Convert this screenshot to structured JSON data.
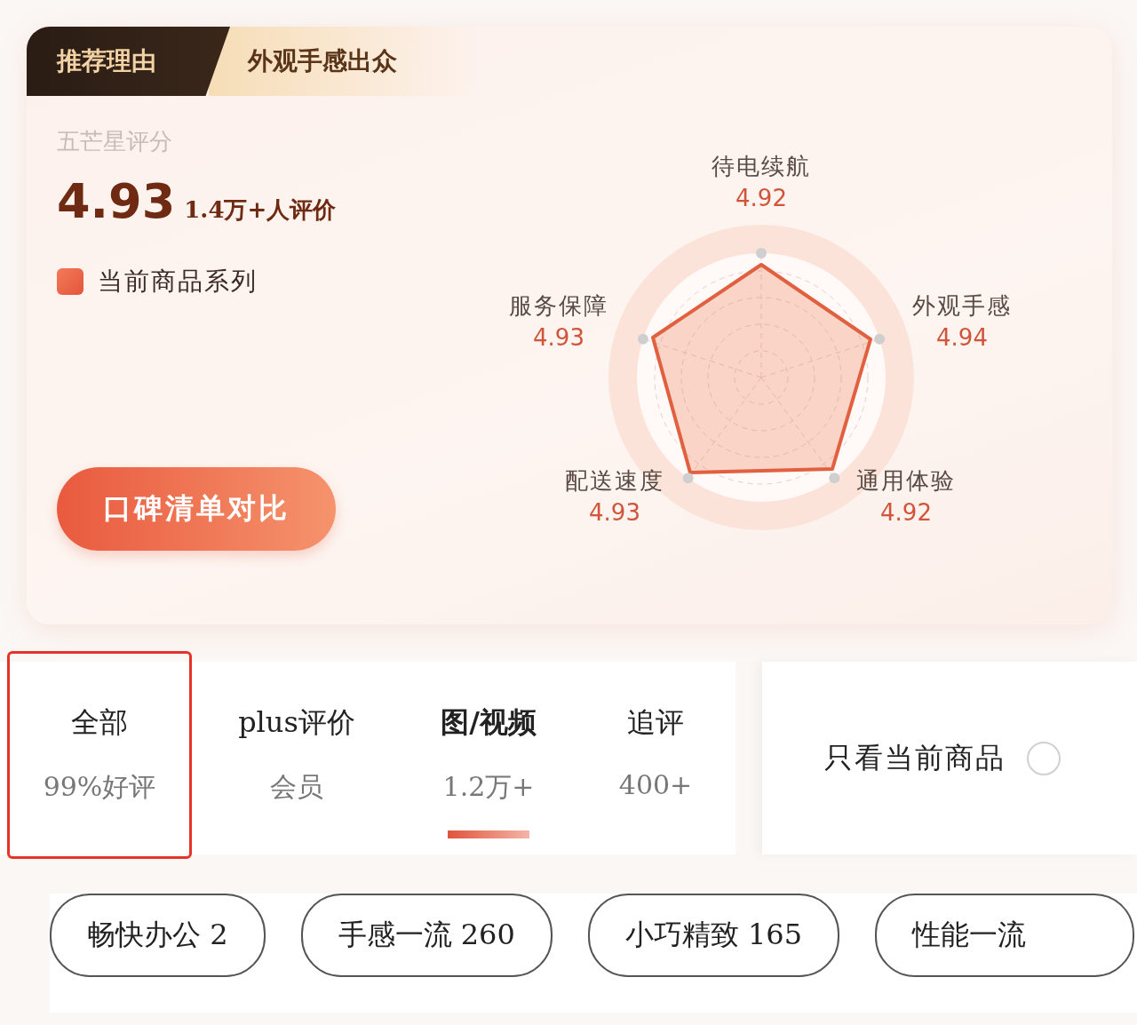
{
  "recommend": {
    "tag": "推荐理由",
    "reason": "外观手感出众"
  },
  "rating": {
    "label": "五芒星评分",
    "score": "4.93",
    "count": "1.4万+人评价",
    "legend": "当前商品系列",
    "button": "口碑清单对比"
  },
  "radar": {
    "axes": [
      {
        "name": "待电续航",
        "value": "4.92"
      },
      {
        "name": "服务保障",
        "value": "4.93"
      },
      {
        "name": "外观手感",
        "value": "4.94"
      },
      {
        "name": "配送速度",
        "value": "4.93"
      },
      {
        "name": "通用体验",
        "value": "4.92"
      }
    ]
  },
  "tabs": [
    {
      "title": "全部",
      "subtitle": "99%好评",
      "selected": false,
      "highlighted": true
    },
    {
      "title": "plus评价",
      "subtitle": "会员",
      "selected": false,
      "highlighted": false
    },
    {
      "title": "图/视频",
      "subtitle": "1.2万+",
      "selected": true,
      "highlighted": false
    },
    {
      "title": "追评",
      "subtitle": "400+",
      "selected": false,
      "highlighted": false
    }
  ],
  "filter": {
    "label": "只看当前商品",
    "checked": false
  },
  "tags": [
    {
      "label": "畅快办公",
      "count": "2"
    },
    {
      "label": "手感一流",
      "count": "260"
    },
    {
      "label": "小巧精致",
      "count": "165"
    },
    {
      "label": "性能一流"
    }
  ]
}
